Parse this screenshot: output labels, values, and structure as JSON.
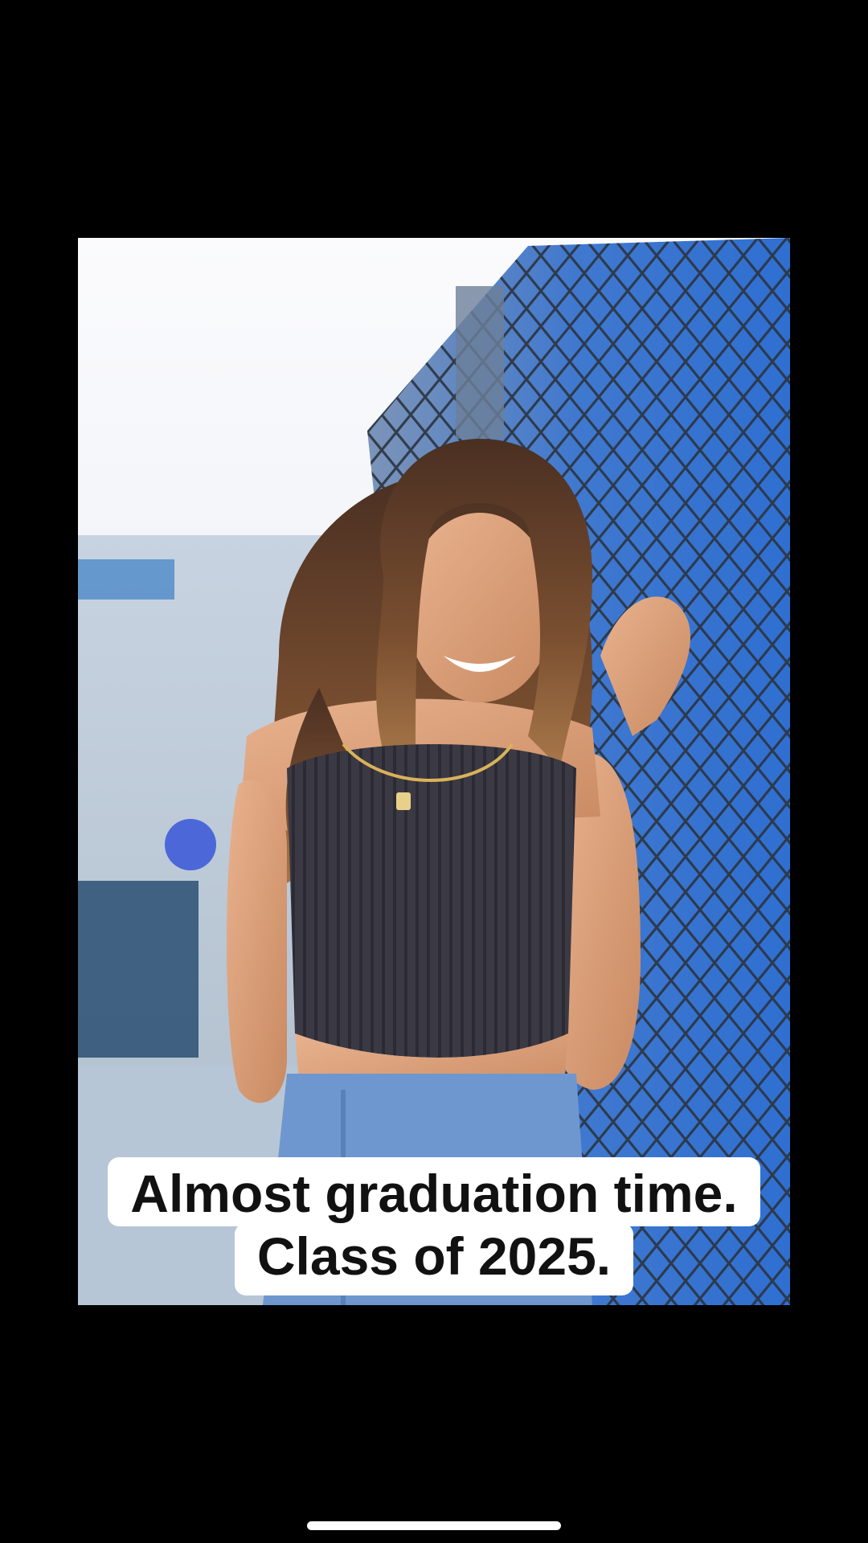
{
  "caption": {
    "line1": "Almost graduation time.",
    "line2": "Class of 2025."
  },
  "photo": {
    "subject": "portrait-photo"
  },
  "colors": {
    "background": "#000000",
    "caption_bg": "#ffffff",
    "caption_text": "#111111",
    "fence_blue": "#2f6fd1",
    "top_gray": "#3b3944"
  }
}
